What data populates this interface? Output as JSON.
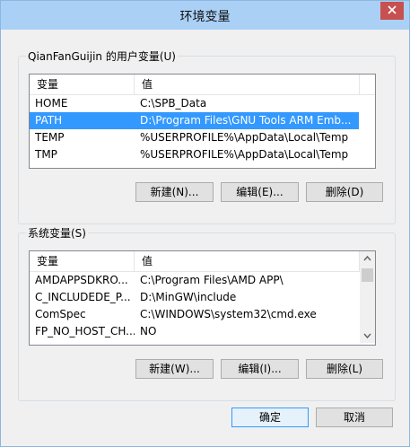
{
  "window": {
    "title": "环境变量",
    "close_label": "×"
  },
  "user_vars": {
    "group_label": "QianFanGuijin 的用户变量(U)",
    "col_name": "变量",
    "col_value": "值",
    "rows": [
      {
        "name": "HOME",
        "value": "C:\\SPB_Data"
      },
      {
        "name": "PATH",
        "value": "D:\\Program Files\\GNU Tools ARM Emb..."
      },
      {
        "name": "TEMP",
        "value": "%USERPROFILE%\\AppData\\Local\\Temp"
      },
      {
        "name": "TMP",
        "value": "%USERPROFILE%\\AppData\\Local\\Temp"
      }
    ],
    "selected_row": "PATH",
    "new_label": "新建(N)...",
    "edit_label": "编辑(E)...",
    "delete_label": "删除(D)"
  },
  "system_vars": {
    "group_label": "系统变量(S)",
    "col_name": "变量",
    "col_value": "值",
    "rows": [
      {
        "name": "AMDAPPSDKRO...",
        "value": "C:\\Program Files\\AMD APP\\"
      },
      {
        "name": "C_INCLUDEDE_P...",
        "value": "D:\\MinGW\\include"
      },
      {
        "name": "ComSpec",
        "value": "C:\\WINDOWS\\system32\\cmd.exe"
      },
      {
        "name": "FP_NO_HOST_CH...",
        "value": "NO"
      }
    ],
    "new_label": "新建(W)...",
    "edit_label": "编辑(I)...",
    "delete_label": "删除(L)"
  },
  "footer": {
    "ok_label": "确定",
    "cancel_label": "取消"
  },
  "colors": {
    "titlebar": "#aad0f6",
    "selection": "#3399ff",
    "close_button": "#c75050"
  }
}
